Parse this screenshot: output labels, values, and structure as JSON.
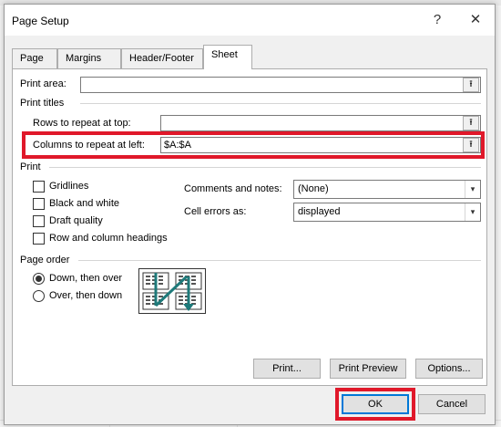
{
  "dialog": {
    "title": "Page Setup",
    "help_glyph": "?",
    "close_glyph": "✕"
  },
  "tabs": [
    {
      "label": "Page",
      "active": false
    },
    {
      "label": "Margins",
      "active": false
    },
    {
      "label": "Header/Footer",
      "active": false
    },
    {
      "label": "Sheet",
      "active": true
    }
  ],
  "sheet": {
    "print_area_label": "Print area:",
    "print_area_value": "",
    "print_titles_header": "Print titles",
    "rows_repeat_label": "Rows to repeat at top:",
    "rows_repeat_value": "",
    "cols_repeat_label": "Columns to repeat at left:",
    "cols_repeat_value": "$A:$A",
    "print_header": "Print",
    "checkboxes": [
      {
        "label": "Gridlines",
        "checked": false
      },
      {
        "label": "Black and white",
        "checked": false
      },
      {
        "label": "Draft quality",
        "checked": false
      },
      {
        "label": "Row and column headings",
        "checked": false
      }
    ],
    "comments_label": "Comments and notes:",
    "comments_value": "(None)",
    "cell_errors_label": "Cell errors as:",
    "cell_errors_value": "displayed",
    "page_order_header": "Page order",
    "radios": [
      {
        "label": "Down, then over",
        "selected": true
      },
      {
        "label": "Over, then down",
        "selected": false
      }
    ]
  },
  "buttons": {
    "print": "Print...",
    "print_preview": "Print Preview",
    "options": "Options...",
    "ok": "OK",
    "cancel": "Cancel"
  },
  "colors": {
    "highlight": "#e0182a",
    "accent": "#0078d7",
    "order_arrow": "#1e7a7a"
  },
  "icons": {
    "range_picker": "collapse-dialog-arrow-icon",
    "dropdown": "chevron-down-icon",
    "page_order": "page-order-diagram-icon"
  }
}
